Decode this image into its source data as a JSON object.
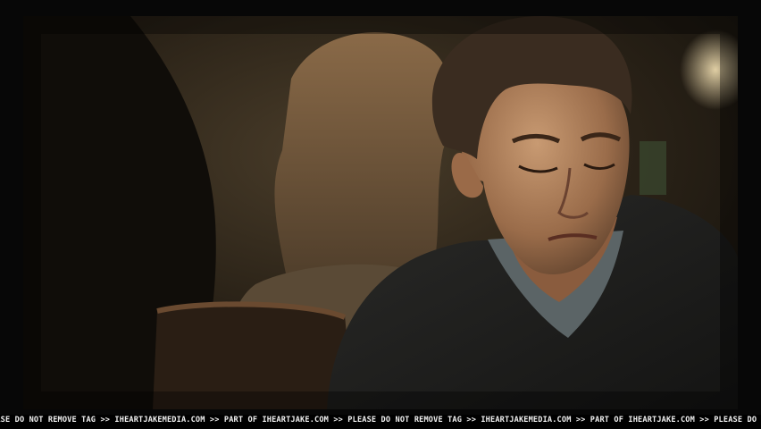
{
  "watermark": {
    "text": "EASE DO NOT REMOVE TAG >> IHEARTJAKEMEDIA.COM >> PART OF IHEARTJAKE.COM >> PLEASE DO NOT REMOVE TAG >> IHEARTJAKEMEDIA.COM >> PART OF IHEARTJAKE.COM >> PLEASE DO NOT REMOVE TAG >> IHEARTJAKEN"
  }
}
